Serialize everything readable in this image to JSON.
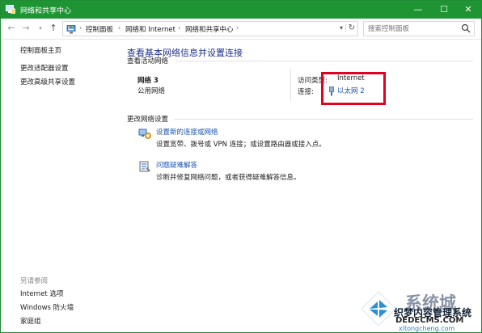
{
  "window": {
    "title": "网络和共享中心",
    "controls": {
      "minimize": "—",
      "maximize": "☐",
      "close": "✕"
    }
  },
  "address": {
    "crumbs": [
      "控制面板",
      "网络和 Internet",
      "网络和共享中心"
    ],
    "search_placeholder": "搜索控制面板"
  },
  "sidebar": {
    "links": [
      "控制面板主页",
      "更改适配器设置",
      "更改高级共享设置"
    ],
    "see_also_heading": "另请参阅",
    "see_also": [
      "Internet 选项",
      "Windows 防火墙",
      "家庭组"
    ]
  },
  "main": {
    "title": "查看基本网络信息并设置连接",
    "active_networks_heading": "查看活动网络",
    "network": {
      "name": "网络  3",
      "type": "公用网络",
      "access_label": "访问类型:",
      "access_value": "Internet",
      "connection_label": "连接:",
      "connection_value": "以太网 2"
    },
    "change_settings_heading": "更改网络设置",
    "tasks": [
      {
        "link": "设置新的连接或网络",
        "desc": "设置宽带、拨号或 VPN 连接；或设置路由器或接入点。"
      },
      {
        "link": "问题疑难解答",
        "desc": "诊断并修复网络问题，或者获得疑难解答信息。"
      }
    ]
  },
  "watermark": {
    "brand": "系统城",
    "line1": "织梦内容管理系统",
    "line2": "DEDECMS.COM",
    "line3": "xitongcheng.com"
  },
  "colors": {
    "titlebar": "#1f9433",
    "link": "#1a56b0",
    "title_blue": "#1e3287",
    "highlight": "#e4001e"
  }
}
